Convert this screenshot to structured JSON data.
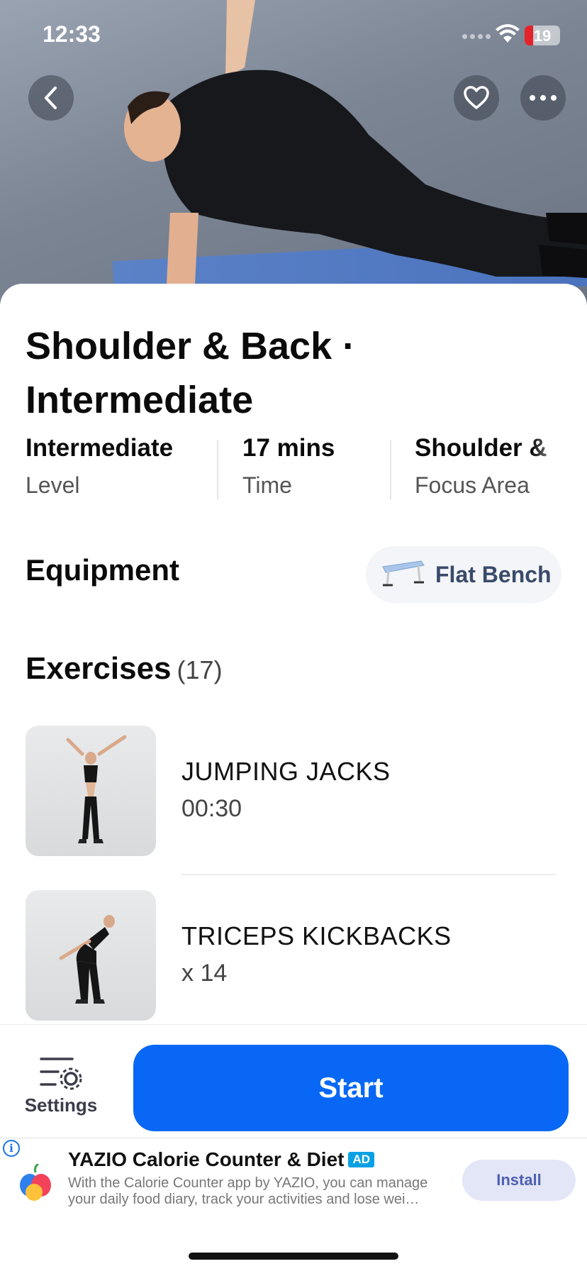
{
  "status_bar": {
    "time": "12:33",
    "battery": "19"
  },
  "hero": {
    "back_icon": "chevron-left-icon",
    "favorite_icon": "heart-icon",
    "more_icon": "ellipsis-icon"
  },
  "workout": {
    "title": "Shoulder & Back · Intermediate",
    "stats": [
      {
        "value": "Intermediate",
        "label": "Level"
      },
      {
        "value": "17 mins",
        "label": "Time"
      },
      {
        "value": "Shoulder &",
        "label": "Focus Area"
      }
    ]
  },
  "equipment": {
    "heading": "Equipment",
    "items": [
      {
        "label": "Flat Bench",
        "icon": "bench-icon"
      }
    ]
  },
  "exercises": {
    "heading": "Exercises",
    "count": "(17)",
    "items": [
      {
        "name": "JUMPING JACKS",
        "detail": "00:30"
      },
      {
        "name": "TRICEPS KICKBACKS",
        "detail": "x 14"
      }
    ]
  },
  "bottom_bar": {
    "settings_label": "Settings",
    "start_label": "Start"
  },
  "ad": {
    "title": "YAZIO Calorie Counter & Diet",
    "badge": "AD",
    "body": "With the Calorie Counter app by YAZIO, you can manage your daily food diary, track your activities and lose wei…",
    "install_label": "Install"
  },
  "colors": {
    "primary": "#0868f5",
    "text": "#0b0b0b",
    "ad_install_bg": "#e3e6f7"
  }
}
